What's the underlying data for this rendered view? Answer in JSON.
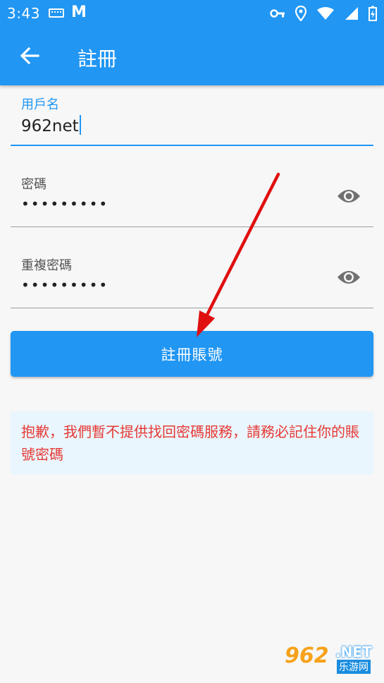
{
  "status": {
    "time": "3:43"
  },
  "appbar": {
    "title": "註冊"
  },
  "form": {
    "username": {
      "label": "用戶名",
      "value": "962net"
    },
    "password": {
      "label": "密碼",
      "value": "•••••••••"
    },
    "confirm": {
      "label": "重複密碼",
      "value": "•••••••••"
    },
    "submit_label": "註冊賬號"
  },
  "notice": {
    "text": "抱歉，我們暫不提供找回密碼服務，請務必記住你的賬號密碼"
  },
  "watermark": {
    "num": "962",
    "net": ".NET",
    "cn": "乐游网"
  },
  "colors": {
    "accent": "#2196f3",
    "warning": "#e53935",
    "notice_bg": "#eaf6fd",
    "annotation_arrow": "#e01010"
  }
}
